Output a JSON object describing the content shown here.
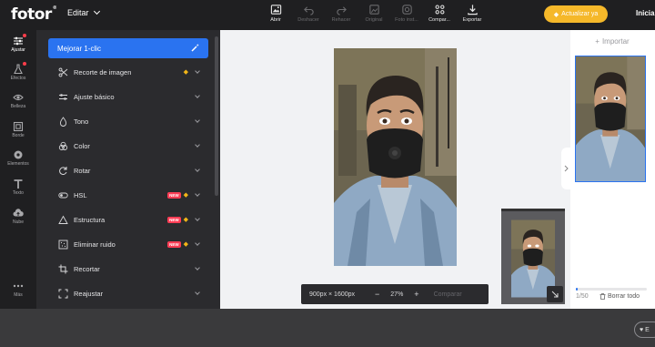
{
  "app": {
    "logo": "fotor",
    "logo_mark": "®",
    "editor_menu": "Editar"
  },
  "toolbar": [
    {
      "label": "Abrir",
      "icon": "open-image-icon",
      "enabled": true
    },
    {
      "label": "Deshacer",
      "icon": "undo-icon",
      "enabled": false
    },
    {
      "label": "Rehacer",
      "icon": "redo-icon",
      "enabled": false
    },
    {
      "label": "Original",
      "icon": "original-image-icon",
      "enabled": false
    },
    {
      "label": "Foto inst...",
      "icon": "instagram-icon",
      "enabled": false
    },
    {
      "label": "Compar...",
      "icon": "share-icon",
      "enabled": true
    },
    {
      "label": "Exportar",
      "icon": "download-icon",
      "enabled": true
    }
  ],
  "upgrade": {
    "label": "Actualizar ya",
    "icon": "diamond-icon",
    "color": "#f5b82a"
  },
  "login": "Inicia",
  "rail": [
    {
      "label": "Ajustar",
      "icon": "sliders-icon",
      "active": true,
      "dot": true
    },
    {
      "label": "Efectos",
      "icon": "flask-icon",
      "active": false,
      "dot": true
    },
    {
      "label": "Belleza",
      "icon": "eye-icon",
      "active": false,
      "dot": false
    },
    {
      "label": "Borde",
      "icon": "frame-icon",
      "active": false,
      "dot": false
    },
    {
      "label": "Elementos",
      "icon": "shapes-icon",
      "active": false,
      "dot": false
    },
    {
      "label": "Texto",
      "icon": "text-icon",
      "active": false,
      "dot": false
    },
    {
      "label": "Nube",
      "icon": "cloud-icon",
      "active": false,
      "dot": false
    },
    {
      "label": "Más",
      "icon": "more-icon",
      "active": false,
      "dot": false
    }
  ],
  "panel": {
    "enhance": {
      "label": "Mejorar 1-clic",
      "icon": "magic-wand-icon"
    },
    "items": [
      {
        "label": "Recorte de imagen",
        "icon": "scissors-icon",
        "new": false,
        "premium": true
      },
      {
        "label": "Ajuste básico",
        "icon": "sliders-icon",
        "new": false,
        "premium": false
      },
      {
        "label": "Tono",
        "icon": "drop-icon",
        "new": false,
        "premium": false
      },
      {
        "label": "Color",
        "icon": "color-circles-icon",
        "new": false,
        "premium": false
      },
      {
        "label": "Rotar",
        "icon": "rotate-icon",
        "new": false,
        "premium": false
      },
      {
        "label": "HSL",
        "icon": "toggle-icon",
        "new": true,
        "premium": true
      },
      {
        "label": "Estructura",
        "icon": "triangle-icon",
        "new": true,
        "premium": true
      },
      {
        "label": "Eliminar ruido",
        "icon": "noise-icon",
        "new": true,
        "premium": true
      },
      {
        "label": "Recortar",
        "icon": "crop-icon",
        "new": false,
        "premium": false
      },
      {
        "label": "Reajustar",
        "icon": "resize-icon",
        "new": false,
        "premium": false
      }
    ],
    "new_badge": "NEW"
  },
  "statusbar": {
    "dimensions": "900px × 1600px",
    "minus": "−",
    "zoom": "27%",
    "plus": "+",
    "compare": "Comparar"
  },
  "rightpanel": {
    "import_label": "Importar",
    "count": "1/50",
    "progress": 0.02,
    "clear_label": "Borrar todo"
  },
  "chat": {
    "label": "E",
    "icon": "heart-icon"
  },
  "colors": {
    "accent": "#2a73f0",
    "premium": "#f2b517",
    "new_badge": "#ff3d55"
  }
}
